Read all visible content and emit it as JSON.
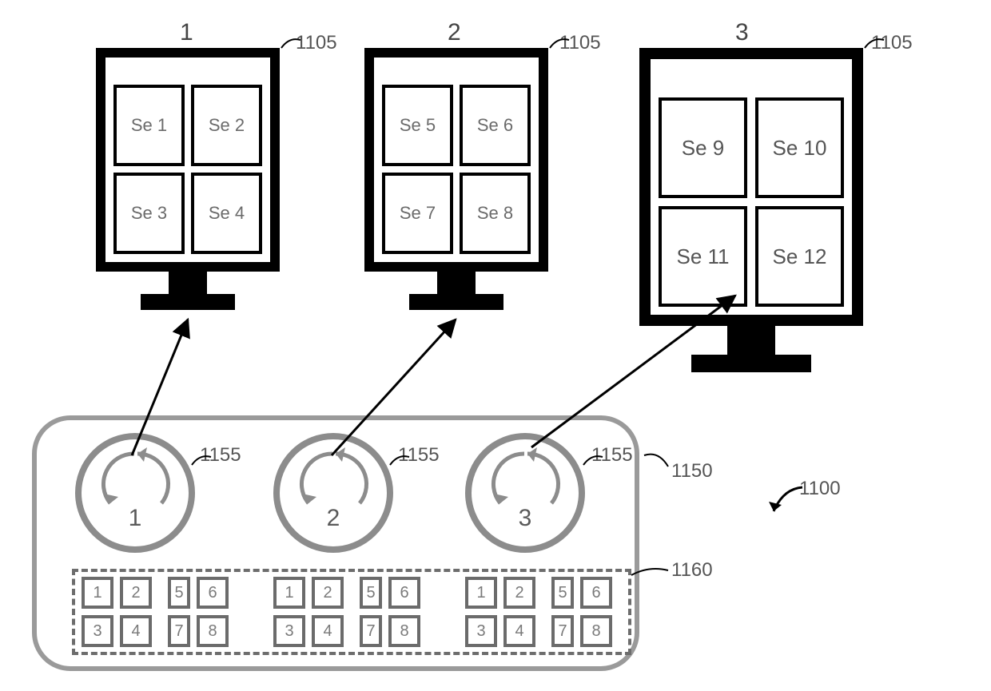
{
  "monitors": [
    {
      "label": "1",
      "cells": [
        "Se 1",
        "Se 2",
        "Se 3",
        "Se 4"
      ]
    },
    {
      "label": "2",
      "cells": [
        "Se 5",
        "Se 6",
        "Se 7",
        "Se 8"
      ]
    },
    {
      "label": "3",
      "cells": [
        "Se 9",
        "Se 10",
        "Se 11",
        "Se 12"
      ]
    }
  ],
  "dials": [
    {
      "number": "1"
    },
    {
      "number": "2"
    },
    {
      "number": "3"
    }
  ],
  "key_labels": [
    "1",
    "2",
    "5",
    "6",
    "3",
    "4",
    "7",
    "8"
  ],
  "callouts": {
    "monitor_ref": "1105",
    "dial_ref": "1155",
    "panel_ref": "1150",
    "keygroup_ref": "1160",
    "figure_ref": "1100"
  }
}
